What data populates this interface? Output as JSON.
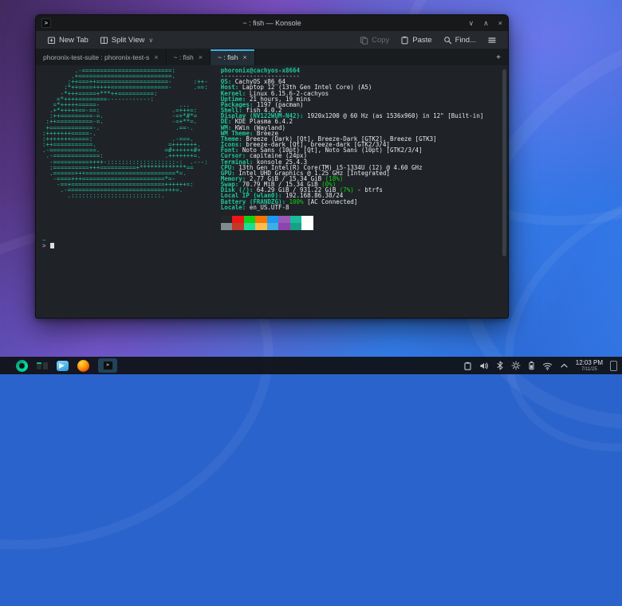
{
  "window": {
    "title": "~ : fish — Konsole",
    "controls": {
      "minimize": "∨",
      "maximize": "∧",
      "close": "×"
    },
    "toolbar": {
      "new_tab": "New Tab",
      "split_view": "Split View",
      "split_chevron": "∨",
      "copy": "Copy",
      "paste": "Paste",
      "find": "Find..."
    },
    "tabs": [
      {
        "label": "phoronix-test-suite : phoronix-test-s",
        "active": false
      },
      {
        "label": "~ : fish",
        "active": false
      },
      {
        "label": "~ : fish",
        "active": true
      }
    ],
    "new_tab_plus": "+"
  },
  "terminal": {
    "user_host": "phoronix@cachyos-x8664",
    "separator": "----------------------",
    "ascii_art": "         .-=========================:\n        .+==========================.\n       :++===++====================-      :++-\n      :*++====+++++================-      .==:\n     -*+++=====+***++==========:\n    =*++++========------------:\n   =*+++++=====-                      ...\n  .+*+++++==-==:                    .=+++=:\n  :++=========-=.                   -=+*#*=\n :++==========-=.                   -=+**=.\n +============-.                     .==-.\n:+++++++=====-.\n:+++++++=====:                      .-===.\n:++===========.                    =+++++++.\n.-=============.                  =#++++++#+\n .-=============:                 .+++++++=.\n  -==========++++-:::::::::::::::::::-:  .---:\n  :==========+++==========+*************==\n  .======+++=========================*=.\n   -====+++=======================*=-\n    -==+==========================++++++=:\n     .-===========================+++=.\n       .:::::::::::::::::::::::::.",
    "info_lines": [
      {
        "label": "OS",
        "value": "CachyOS x86_64"
      },
      {
        "label": "Host",
        "value": "Laptop 12 (13th Gen Intel Core) (A5)"
      },
      {
        "label": "Kernel",
        "value": "Linux 6.15.6-2-cachyos"
      },
      {
        "label": "Uptime",
        "value": "21 hours, 19 mins"
      },
      {
        "label": "Packages",
        "value": "1197 (pacman)"
      },
      {
        "label": "Shell",
        "value": "fish 4.0.2"
      },
      {
        "label": "Display (NV122WUM-N42)",
        "value": "1920x1200 @ 60 Hz (as 1536x960) in 12\" [Built-in]"
      },
      {
        "label": "DE",
        "value": "KDE Plasma 6.4.2"
      },
      {
        "label": "WM",
        "value": "KWin (Wayland)"
      },
      {
        "label": "WM Theme",
        "value": "Breeze"
      },
      {
        "label": "Theme",
        "value": "Breeze (Dark) [Qt], Breeze-Dark [GTK2], Breeze [GTK3]"
      },
      {
        "label": "Icons",
        "value": "breeze-dark [Qt], breeze-dark [GTK2/3/4]"
      },
      {
        "label": "Font",
        "value": "Noto Sans (10pt) [Qt], Noto Sans (10pt) [GTK2/3/4]"
      },
      {
        "label": "Cursor",
        "value": "capitaine (24px)"
      },
      {
        "label": "Terminal",
        "value": "konsole 25.4.3"
      },
      {
        "label": "CPU",
        "value": "13th Gen Intel(R) Core(TM) i5-1334U (12) @ 4.60 GHz"
      },
      {
        "label": "GPU",
        "value": "Intel UHD Graphics @ 1.25 GHz [Integrated]"
      },
      {
        "label": "Memory",
        "value": "2.77 GiB / 15.34 GiB ",
        "highlight": "(18%)"
      },
      {
        "label": "Swap",
        "value": "70.79 MiB / 15.34 GiB ",
        "highlight": "(0%)"
      },
      {
        "label": "Disk (/)",
        "value": "64.29 GiB / 931.22 GiB ",
        "highlight": "(7%)",
        "tail": " - btrfs"
      },
      {
        "label": "Local IP (wlan0)",
        "value": "192.168.86.38/24"
      },
      {
        "label": "Battery (FRANDZG)",
        "value": "",
        "highlight": "100%",
        "tail": " [AC Connected]"
      },
      {
        "label": "Locale",
        "value": "en_US.UTF-8"
      }
    ],
    "palette_top": [
      "#232627",
      "#ed1515",
      "#11d116",
      "#f67400",
      "#1d99f3",
      "#9b59b6",
      "#1abc9c",
      "#fcfcfc"
    ],
    "palette_bottom": [
      "#7f8c8d",
      "#c0392b",
      "#1cdc9a",
      "#fdbc4b",
      "#3daee9",
      "#8e44ad",
      "#16a085",
      "#ffffff"
    ],
    "prompt_path": "~",
    "prompt_char": ">",
    "app_icon_glyph": ">_"
  },
  "taskbar": {
    "clock_time": "12:03 PM",
    "clock_date": "7/11/25"
  },
  "colors": {
    "accent": "#3daee9",
    "terminal_green": "#1dc79a",
    "highlight_green": "#11d116",
    "terminal_background": "#1f2327"
  }
}
